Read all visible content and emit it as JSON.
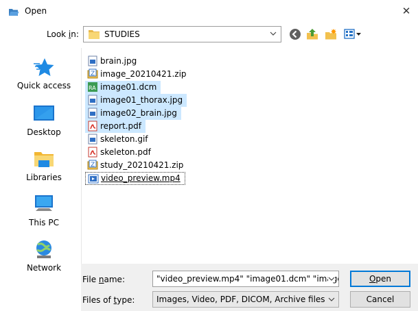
{
  "window": {
    "title": "Open",
    "close_glyph": "✕"
  },
  "toolbar": {
    "lookin_label": "Look in:",
    "lookin_value": "STUDIES",
    "icons": [
      "back-icon",
      "up-folder-icon",
      "new-folder-icon",
      "view-menu-icon"
    ]
  },
  "places": [
    {
      "label": "Quick access",
      "icon": "quick-access-star-icon"
    },
    {
      "label": "Desktop",
      "icon": "desktop-icon"
    },
    {
      "label": "Libraries",
      "icon": "libraries-icon"
    },
    {
      "label": "This PC",
      "icon": "this-pc-icon"
    },
    {
      "label": "Network",
      "icon": "network-icon"
    }
  ],
  "files": [
    {
      "name": "brain.jpg",
      "icon": "image-file-icon",
      "selected": false
    },
    {
      "name": "image_20210421.zip",
      "icon": "zip-file-icon",
      "selected": false
    },
    {
      "name": "image01.dcm",
      "icon": "dicom-file-icon",
      "selected": true
    },
    {
      "name": "image01_thorax.jpg",
      "icon": "image-file-icon",
      "selected": true
    },
    {
      "name": "image02_brain.jpg",
      "icon": "image-file-icon",
      "selected": true
    },
    {
      "name": "report.pdf",
      "icon": "pdf-file-icon",
      "selected": true
    },
    {
      "name": "skeleton.gif",
      "icon": "image-file-icon",
      "selected": false
    },
    {
      "name": "skeleton.pdf",
      "icon": "pdf-file-icon",
      "selected": false
    },
    {
      "name": "study_20210421.zip",
      "icon": "zip-file-icon",
      "selected": false
    },
    {
      "name": "video_preview.mp4",
      "icon": "video-file-icon",
      "selected": false,
      "focused": true
    }
  ],
  "bottom": {
    "filename_label_pre": "File ",
    "filename_label_u": "n",
    "filename_label_post": "ame:",
    "filename_value": "\"video_preview.mp4\" \"image01.dcm\" \"image0",
    "filetype_label_pre": "Files of ",
    "filetype_label_u": "t",
    "filetype_label_post": "ype:",
    "filetype_value": "Images, Video, PDF, DICOM, Archive files",
    "open_pre": "",
    "open_u": "O",
    "open_post": "pen",
    "cancel_label": "Cancel"
  },
  "colors": {
    "selection": "#cce8ff",
    "accent": "#0078d7",
    "folder": "#f8d775"
  }
}
